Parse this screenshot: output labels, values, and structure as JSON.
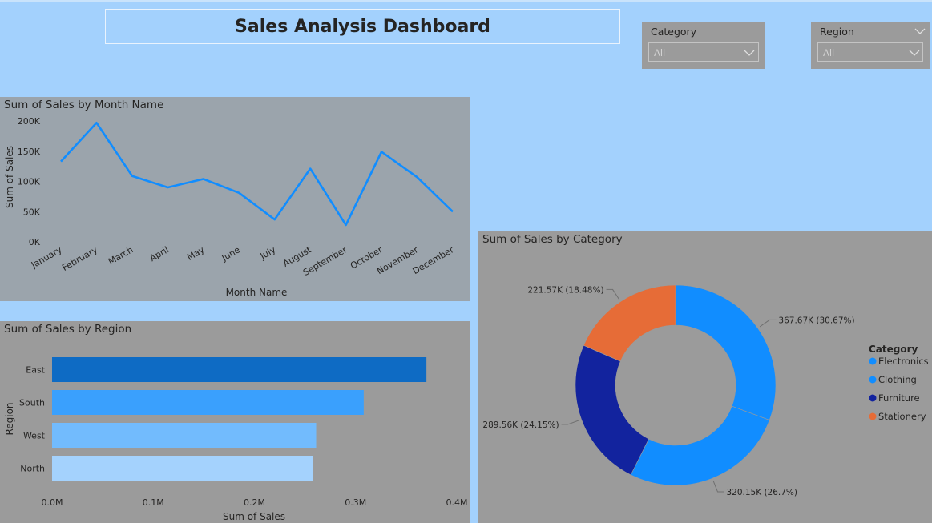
{
  "dashboard": {
    "title": "Sales Analysis Dashboard"
  },
  "filters": {
    "category": {
      "label": "Category",
      "value": "All"
    },
    "region": {
      "label": "Region",
      "value": "All"
    }
  },
  "colors": {
    "page_bg": "#a3d1fd",
    "line_panel_bg": "#9ba4ac",
    "panel_bg": "#9b9b9b",
    "line_series": "#118dff",
    "electronics": "#118dff",
    "clothing": "#118dff",
    "furniture": "#12239e",
    "stationery": "#e66c37",
    "bar_east": "#0e6bc4",
    "bar_south": "#3aa0fd",
    "bar_west": "#72bbfd",
    "bar_north": "#a4d2fd"
  },
  "chart_data": [
    {
      "type": "line",
      "title": "Sum of Sales by Month Name",
      "xlabel": "Month Name",
      "ylabel": "Sum of Sales",
      "categories": [
        "January",
        "February",
        "March",
        "April",
        "May",
        "June",
        "July",
        "August",
        "September",
        "October",
        "November",
        "December"
      ],
      "values": [
        133000,
        197000,
        109000,
        90000,
        104000,
        81000,
        37000,
        121000,
        28000,
        149000,
        107000,
        50000
      ],
      "yticks": [
        "0K",
        "50K",
        "100K",
        "150K",
        "200K"
      ],
      "ylim": [
        0,
        200000
      ],
      "grid": false
    },
    {
      "type": "bar",
      "orientation": "horizontal",
      "title": "Sum of Sales by Region",
      "xlabel": "Sum of Sales",
      "ylabel": "Region",
      "categories": [
        "East",
        "South",
        "West",
        "North"
      ],
      "values": [
        0.37,
        0.308,
        0.261,
        0.258
      ],
      "value_unit": "M",
      "xticks": [
        "0.0M",
        "0.1M",
        "0.2M",
        "0.3M",
        "0.4M"
      ],
      "xlim": [
        0,
        0.4
      ],
      "grid": false
    },
    {
      "type": "pie",
      "style": "donut",
      "title": "Sum of Sales by Category",
      "legend_title": "Category",
      "legend_position": "right",
      "slices": [
        {
          "name": "Electronics",
          "value": 367.67,
          "label": "367.67K (30.67%)"
        },
        {
          "name": "Clothing",
          "value": 320.15,
          "label": "320.15K (26.7%)"
        },
        {
          "name": "Furniture",
          "value": 289.56,
          "label": "289.56K (24.15%)"
        },
        {
          "name": "Stationery",
          "value": 221.57,
          "label": "221.57K (18.48%)"
        }
      ]
    }
  ]
}
